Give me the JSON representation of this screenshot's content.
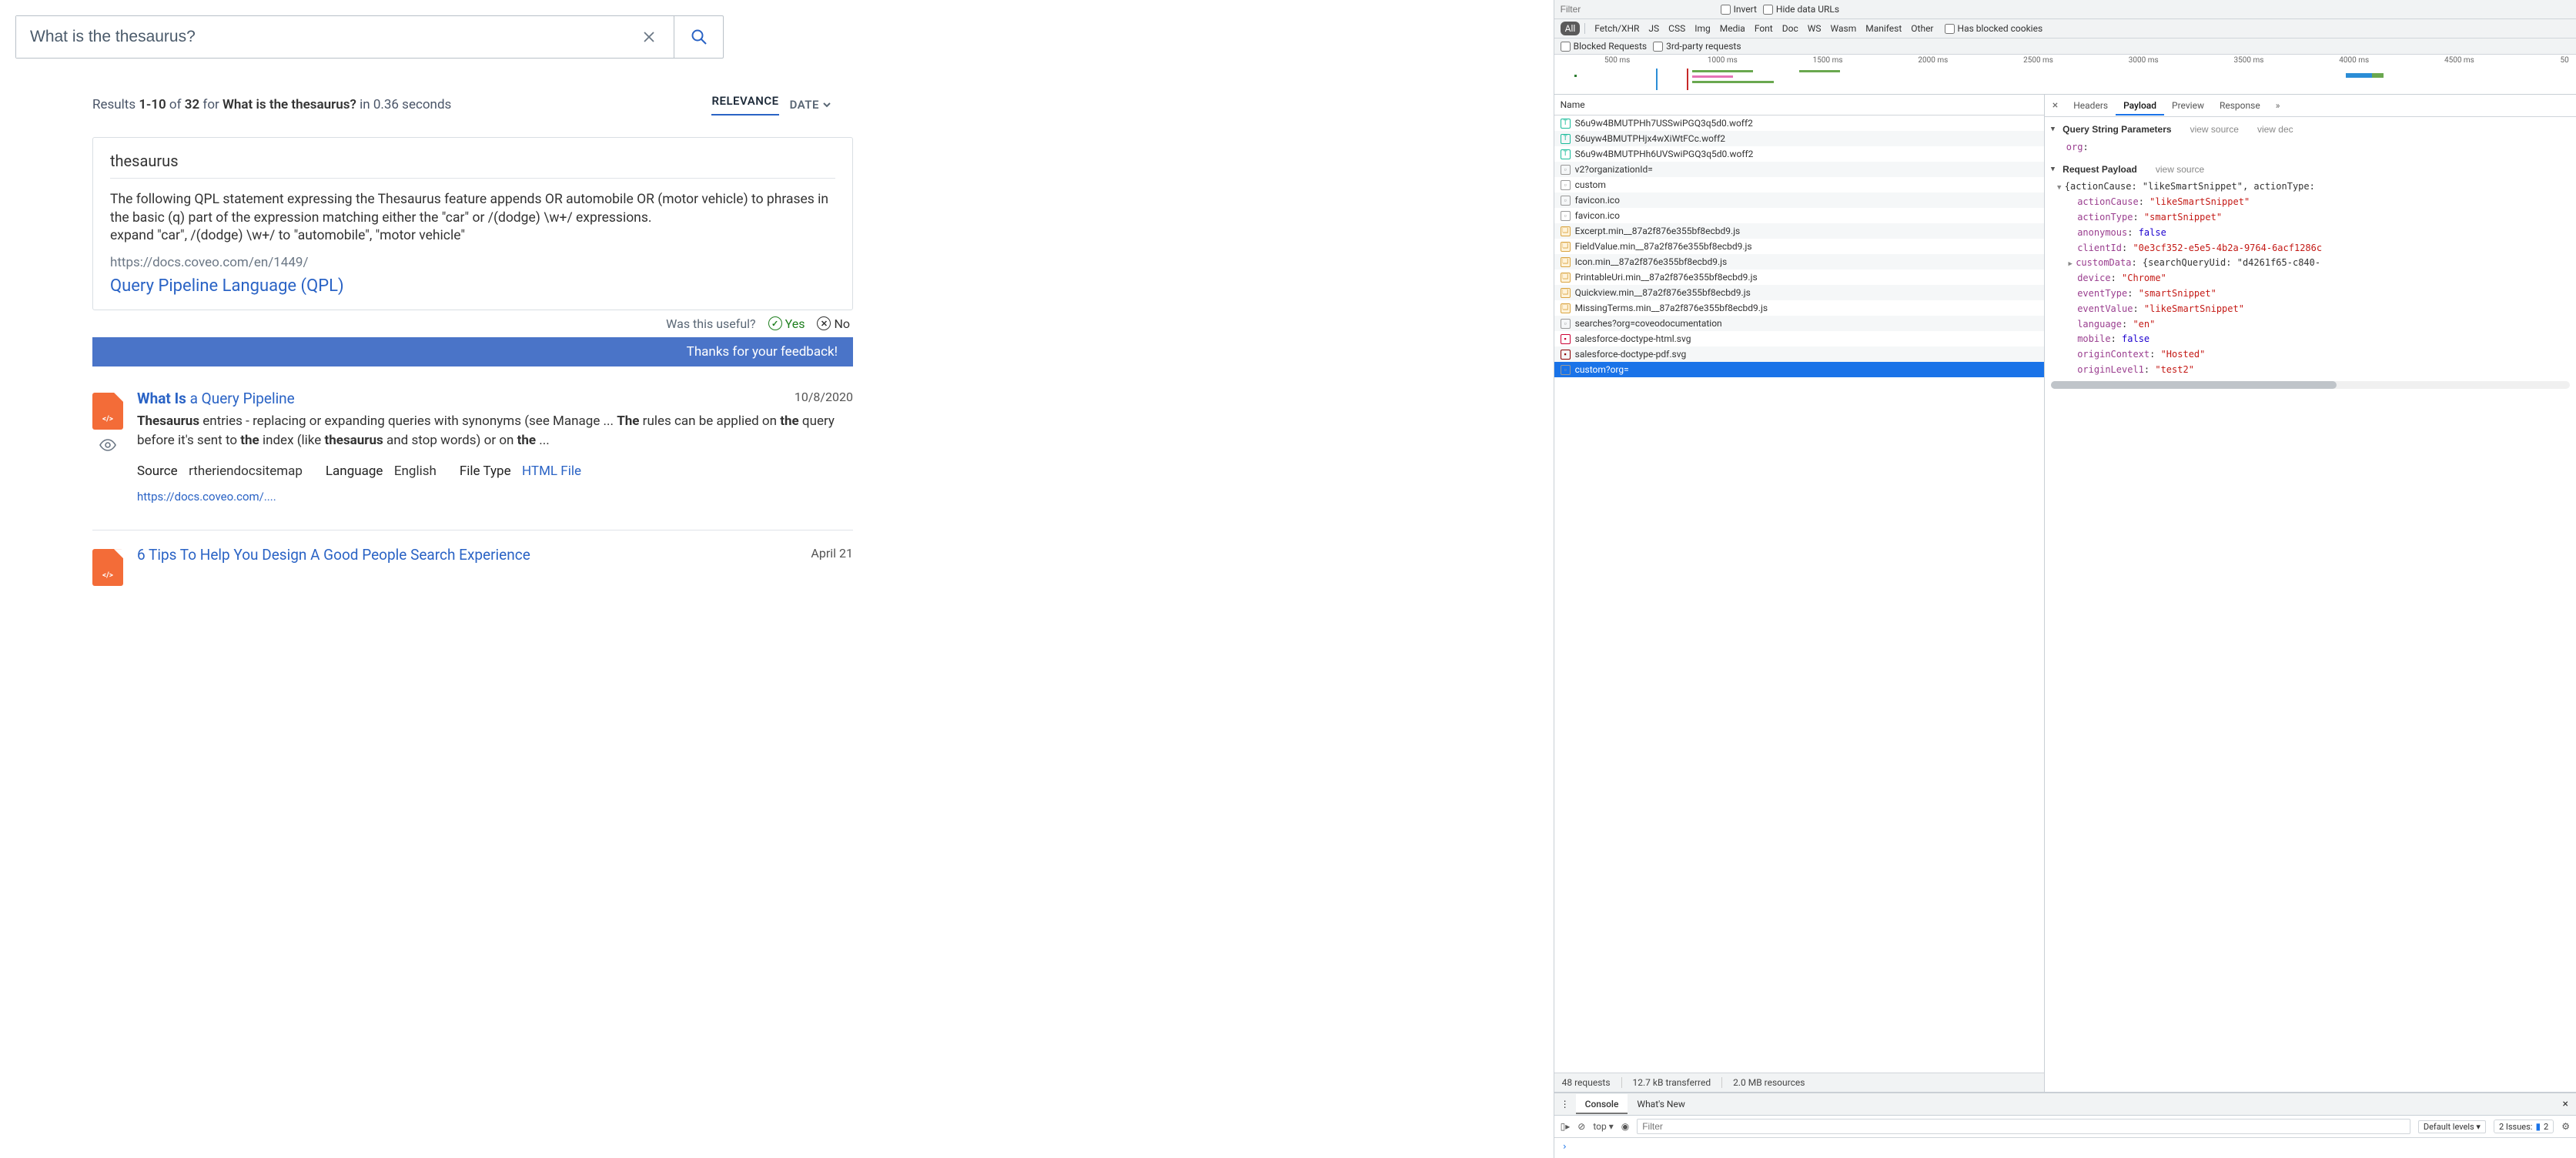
{
  "search": {
    "query": "What is the thesaurus?",
    "summary_pre": "Results ",
    "summary_range": "1-10",
    "summary_of": " of ",
    "summary_total": "32",
    "summary_for": " for ",
    "summary_q": "What is the thesaurus?",
    "summary_time": " in 0.36 seconds",
    "sort_rel": "RELEVANCE",
    "sort_date": "DATE"
  },
  "snippet": {
    "title": "thesaurus",
    "body": "The following QPL statement expressing the Thesaurus feature appends OR automobile OR (motor vehicle) to phrases in the basic (q) part of the expression matching either the \"car\" or /(dodge) \\w+/ expressions.\nexpand \"car\", /(dodge) \\w+/ to \"automobile\", \"motor vehicle\"",
    "url": "https://docs.coveo.com/en/1449/",
    "link": "Query Pipeline Language (QPL)",
    "useful": "Was this useful?",
    "yes": "Yes",
    "no": "No",
    "thanks": "Thanks for your feedback!"
  },
  "results": [
    {
      "title_html": "<b>What Is</b> a Query Pipeline",
      "date": "10/8/2020",
      "excerpt_html": "<b>Thesaurus</b> entries - replacing or expanding queries with synonyms (see Manage ... <b>The</b> rules can be applied on <b>the</b> query before it's sent to <b>the</b> index (like <b>thesaurus</b> and stop words) or on <b>the</b> ...",
      "source_label": "Source",
      "source": "rtheriendocsitemap",
      "lang_label": "Language",
      "lang": "English",
      "ft_label": "File Type",
      "ft": "HTML File",
      "uri": "https://docs.coveo.com/...."
    },
    {
      "title_html": "6 Tips To Help You Design A Good People Search Experience",
      "date": "April 21"
    }
  ],
  "devtools": {
    "filter_placeholder": "Filter",
    "invert": "Invert",
    "hide_urls": "Hide data URLs",
    "types": [
      "All",
      "Fetch/XHR",
      "JS",
      "CSS",
      "Img",
      "Media",
      "Font",
      "Doc",
      "WS",
      "Wasm",
      "Manifest",
      "Other"
    ],
    "has_blocked": "Has blocked cookies",
    "blocked_req": "Blocked Requests",
    "third_party": "3rd-party requests",
    "ticks": [
      "500 ms",
      "1000 ms",
      "1500 ms",
      "2000 ms",
      "2500 ms",
      "3000 ms",
      "3500 ms",
      "4000 ms",
      "4500 ms",
      "50"
    ],
    "name_header": "Name",
    "requests": [
      {
        "icon": "font",
        "name": "S6u9w4BMUTPHh7USSwiPGQ3q5d0.woff2"
      },
      {
        "icon": "font",
        "name": "S6uyw4BMUTPHjx4wXiWtFCc.woff2"
      },
      {
        "icon": "font",
        "name": "S6u9w4BMUTPHh6UVSwiPGQ3q5d0.woff2"
      },
      {
        "icon": "doc",
        "name": "v2?organizationId="
      },
      {
        "icon": "doc",
        "name": "custom"
      },
      {
        "icon": "doc",
        "name": "favicon.ico"
      },
      {
        "icon": "doc",
        "name": "favicon.ico"
      },
      {
        "icon": "js",
        "name": "Excerpt.min__87a2f876e355bf8ecbd9.js"
      },
      {
        "icon": "js",
        "name": "FieldValue.min__87a2f876e355bf8ecbd9.js"
      },
      {
        "icon": "js",
        "name": "Icon.min__87a2f876e355bf8ecbd9.js"
      },
      {
        "icon": "js",
        "name": "PrintableUri.min__87a2f876e355bf8ecbd9.js"
      },
      {
        "icon": "js",
        "name": "Quickview.min__87a2f876e355bf8ecbd9.js"
      },
      {
        "icon": "js",
        "name": "MissingTerms.min__87a2f876e355bf8ecbd9.js"
      },
      {
        "icon": "doc",
        "name": "searches?org=coveodocumentation"
      },
      {
        "icon": "img",
        "name": "salesforce-doctype-html.svg"
      },
      {
        "icon": "pdf",
        "name": "salesforce-doctype-pdf.svg"
      },
      {
        "icon": "doc",
        "name": "custom?org=",
        "selected": true
      }
    ],
    "status": {
      "reqs": "48 requests",
      "xfer": "12.7 kB transferred",
      "res": "2.0 MB resources"
    },
    "detail_tabs": [
      "Headers",
      "Payload",
      "Preview",
      "Response"
    ],
    "qsp_title": "Query String Parameters",
    "view_source": "view source",
    "view_dec": "view dec",
    "qsp_items": [
      {
        "k": "org",
        "v": ""
      }
    ],
    "rp_title": "Request Payload",
    "payload_open": "{actionCause: \"likeSmartSnippet\", actionType:",
    "payload": [
      {
        "k": "actionCause",
        "v": "\"likeSmartSnippet\"",
        "t": "str"
      },
      {
        "k": "actionType",
        "v": "\"smartSnippet\"",
        "t": "str"
      },
      {
        "k": "anonymous",
        "v": "false",
        "t": "lit"
      },
      {
        "k": "clientId",
        "v": "\"0e3cf352-e5e5-4b2a-9764-6acf1286c",
        "t": "str"
      },
      {
        "k": "customData",
        "v": "{searchQueryUid: \"d4261f65-c840-",
        "t": "obj"
      },
      {
        "k": "device",
        "v": "\"Chrome\"",
        "t": "str"
      },
      {
        "k": "eventType",
        "v": "\"smartSnippet\"",
        "t": "str"
      },
      {
        "k": "eventValue",
        "v": "\"likeSmartSnippet\"",
        "t": "str"
      },
      {
        "k": "language",
        "v": "\"en\"",
        "t": "str"
      },
      {
        "k": "mobile",
        "v": "false",
        "t": "lit"
      },
      {
        "k": "originContext",
        "v": "\"Hosted\"",
        "t": "str"
      },
      {
        "k": "originLevel1",
        "v": "\"test2\"",
        "t": "str"
      }
    ],
    "console": {
      "tab1": "Console",
      "tab2": "What's New",
      "top": "top",
      "levels": "Default levels",
      "issues_label": "2 Issues:",
      "issues_count": "2",
      "prompt": "›"
    }
  }
}
